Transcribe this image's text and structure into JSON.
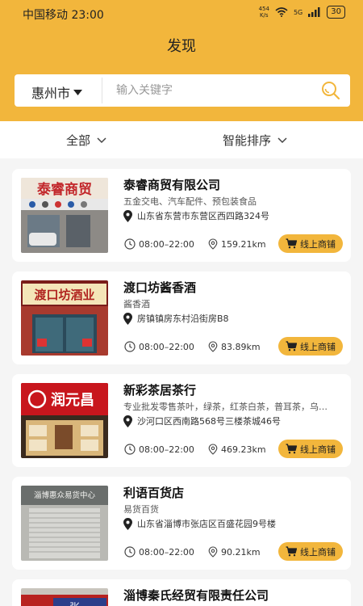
{
  "status": {
    "carrier_time": "中国移动 23:00",
    "net_speed_top": "454",
    "net_speed_bottom": "K/s",
    "signal": "5G",
    "battery": "30"
  },
  "page": {
    "title": "发现"
  },
  "search": {
    "city": "惠州市",
    "placeholder": "输入关键字"
  },
  "filters": {
    "all": "全部",
    "sort": "智能排序"
  },
  "shop_button_label": "线上商铺",
  "stores": [
    {
      "name": "泰睿商贸有限公司",
      "desc": "五金交电、汽车配件、预包装食品",
      "address": "山东省东营市东营区西四路324号",
      "hours": "08:00–22:00",
      "distance": "159.21km",
      "sign": "泰睿商贸"
    },
    {
      "name": "渡口坊酱香酒",
      "desc": "酱香酒",
      "address": "房镇镇房东村沿街房B8",
      "hours": "08:00–22:00",
      "distance": "83.89km",
      "sign": "渡口坊酒业"
    },
    {
      "name": "新彩茶居茶行",
      "desc": "专业批发零售茶叶，绿茶，红茶白茶，普耳茶，乌…",
      "address": "沙河口区西南路568号三楼茶城46号",
      "hours": "08:00–22:00",
      "distance": "469.23km",
      "sign": "润元昌"
    },
    {
      "name": "利语百货店",
      "desc": "易货百货",
      "address": "山东省淄博市张店区百盛花园9号楼",
      "hours": "08:00–22:00",
      "distance": "90.21km",
      "sign": "淄博惠众易货中心"
    },
    {
      "name": "淄博秦氏经贸有限责任公司",
      "desc": "",
      "address": "",
      "hours": "",
      "distance": "",
      "sign": "张"
    }
  ],
  "colors": {
    "accent": "#f2b63c"
  }
}
